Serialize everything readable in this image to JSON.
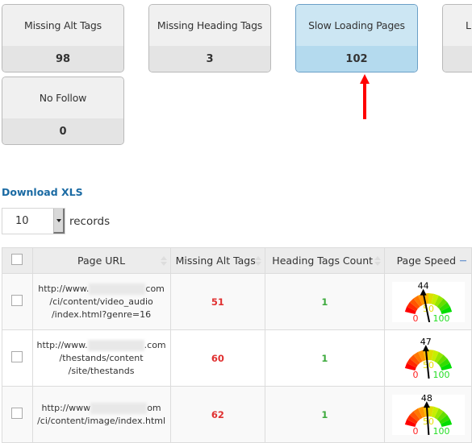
{
  "cards": [
    {
      "title": "Missing Alt Tags",
      "value": "98",
      "active": false
    },
    {
      "title": "Missing Heading Tags",
      "value": "3",
      "active": false
    },
    {
      "title": "Slow Loading Pages",
      "value": "102",
      "active": true
    },
    {
      "title": "L",
      "value": "",
      "active": false
    },
    {
      "title": "No Follow",
      "value": "0",
      "active": false
    }
  ],
  "annotation": {
    "arrow_color": "#ff0000",
    "points_to": "Slow Loading Pages"
  },
  "download": {
    "label": "Download XLS"
  },
  "page_length": {
    "selected": "10",
    "label": "records"
  },
  "table": {
    "columns": [
      {
        "label": "",
        "type": "checkbox"
      },
      {
        "label": "Page URL",
        "sortable": true
      },
      {
        "label": "Missing Alt Tags",
        "sortable": true
      },
      {
        "label": "Heading Tags Count",
        "sortable": true
      },
      {
        "label": "Page Speed",
        "collapse": true
      }
    ],
    "rows": [
      {
        "url_lines": [
          "http://www.",
          "com",
          "/ci/content/video_audio",
          "/index.html?genre=16"
        ],
        "missing_alt_tags": "51",
        "heading_tags_count": "1",
        "page_speed": 44
      },
      {
        "url_lines": [
          "http://www.",
          ".com",
          "/thestands/content",
          "/site/thestands"
        ],
        "missing_alt_tags": "60",
        "heading_tags_count": "1",
        "page_speed": 47
      },
      {
        "url_lines": [
          "http://www",
          "om",
          "/ci/content/image/index.html",
          ""
        ],
        "missing_alt_tags": "62",
        "heading_tags_count": "1",
        "page_speed": 48
      }
    ],
    "gauge": {
      "min_label": "0",
      "mid_label": "50",
      "max_label": "100",
      "min": 0,
      "max": 100
    }
  },
  "colors": {
    "accent": "#1a6aa3",
    "active_card": "#b4daee",
    "red_value": "#e03030",
    "green_value": "#3daa3d"
  }
}
